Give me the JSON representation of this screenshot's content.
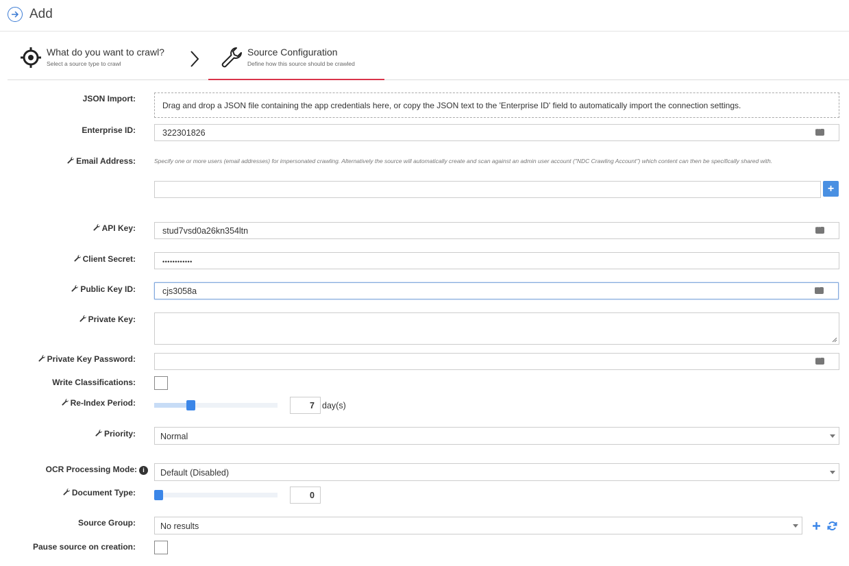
{
  "header": {
    "title": "Add"
  },
  "steps": [
    {
      "title": "What do you want to crawl?",
      "subtitle": "Select a source type to crawl"
    },
    {
      "title": "Source Configuration",
      "subtitle": "Define how this source should be crawled"
    }
  ],
  "form": {
    "json_import": {
      "label": "JSON Import:",
      "text": "Drag and drop a JSON file containing the app credentials here, or copy the JSON text to the 'Enterprise ID' field to automatically import the connection settings."
    },
    "enterprise_id": {
      "label": "Enterprise ID:",
      "value": "322301826"
    },
    "email": {
      "label": "Email Address:",
      "help": "Specify one or more users (email addresses) for impersonated crawling. Alternatively the source will automatically create and scan against an admin user account (\"NDC Crawling Account\") which content can then be specifically shared with.",
      "value": ""
    },
    "api_key": {
      "label": "API Key:",
      "value": "stud7vsd0a26kn354ltn"
    },
    "client_secret": {
      "label": "Client Secret:",
      "value": "••••••••••••"
    },
    "public_key_id": {
      "label": "Public Key ID:",
      "value": "cjs3058a"
    },
    "private_key": {
      "label": "Private Key:",
      "value": ""
    },
    "private_key_password": {
      "label": "Private Key Password:",
      "value": ""
    },
    "write_classifications": {
      "label": "Write Classifications:",
      "checked": false
    },
    "reindex": {
      "label": "Re-Index Period:",
      "value": "7",
      "unit": "day(s)",
      "slider_fraction": 0.26
    },
    "priority": {
      "label": "Priority:",
      "selected": "Normal"
    },
    "ocr": {
      "label": "OCR Processing Mode:",
      "selected": "Default (Disabled)"
    },
    "document_type": {
      "label": "Document Type:",
      "value": "0",
      "slider_fraction": 0.0
    },
    "source_group": {
      "label": "Source Group:",
      "selected": "No results"
    },
    "pause": {
      "label": "Pause source on creation:",
      "checked": false
    }
  },
  "colors": {
    "accent": "#3b86e8",
    "active_step_underline": "#d9344a"
  }
}
